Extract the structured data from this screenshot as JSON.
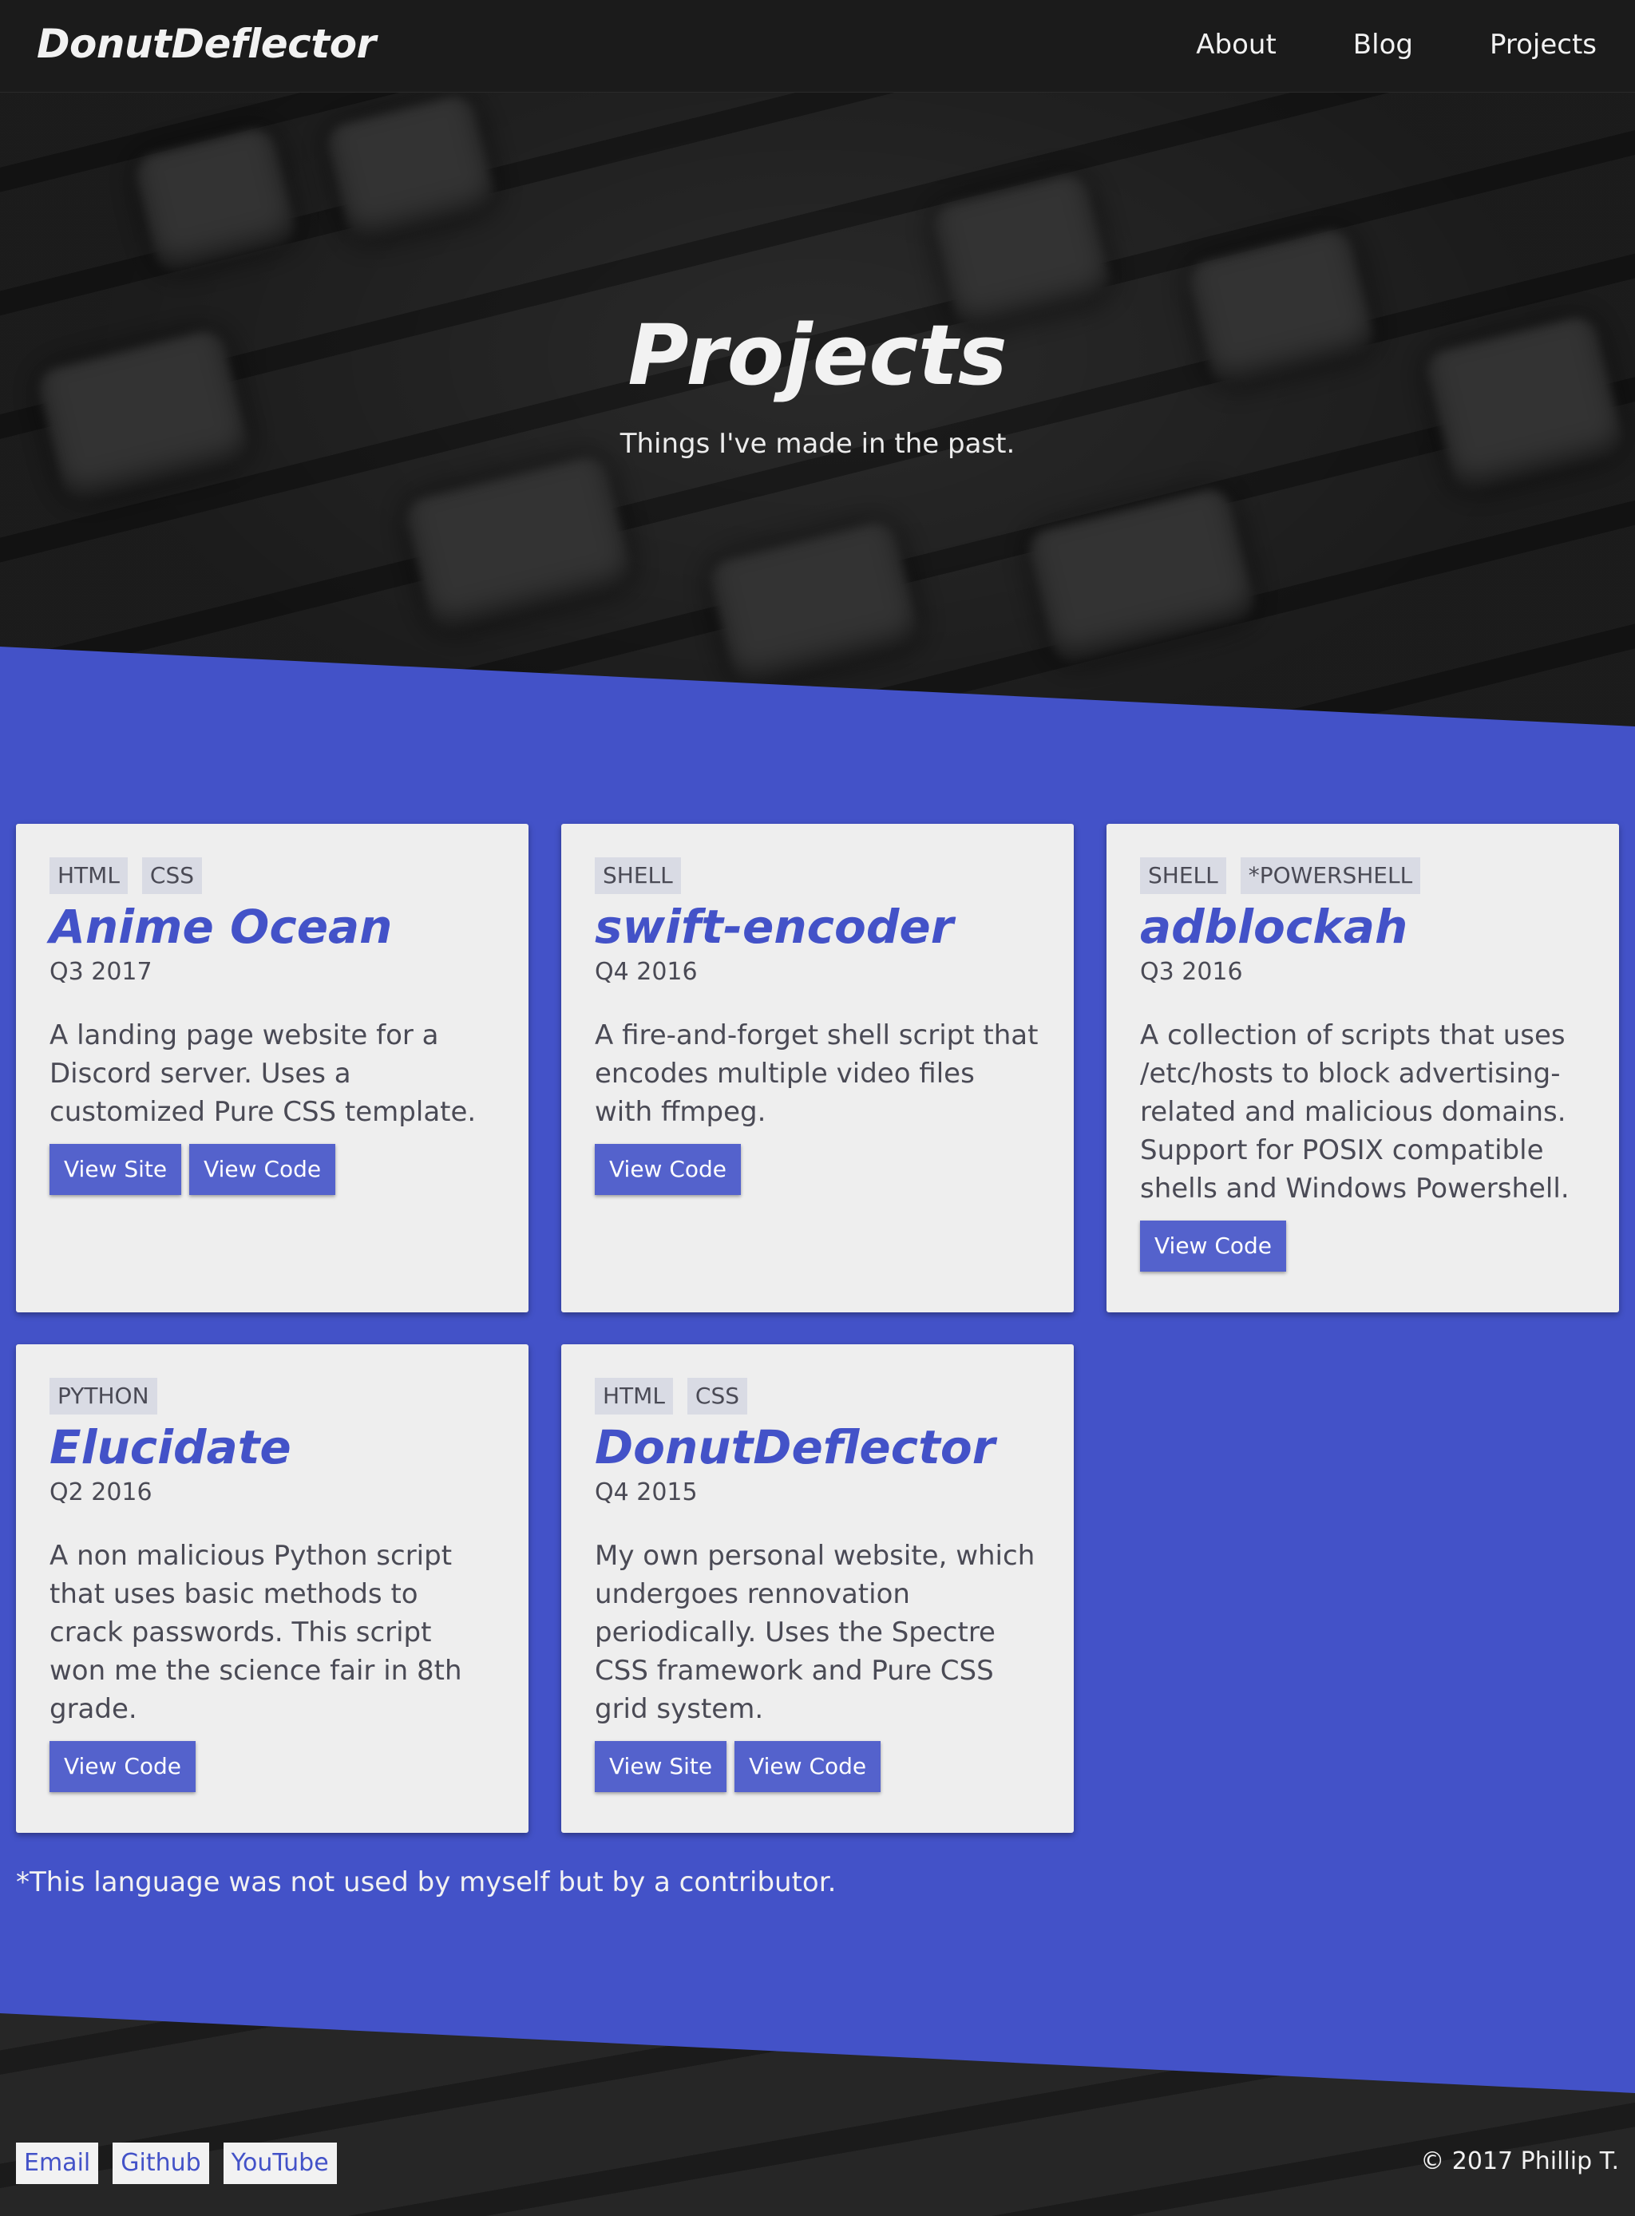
{
  "nav": {
    "brand": "DonutDeflector",
    "links": [
      "About",
      "Blog",
      "Projects"
    ]
  },
  "hero": {
    "title": "Projects",
    "subtitle": "Things I've made in the past."
  },
  "projects": [
    {
      "tags": [
        "HTML",
        "CSS"
      ],
      "title": "Anime Ocean",
      "date": "Q3 2017",
      "description": "A landing page website for a Discord server. Uses a customized Pure CSS template.",
      "buttons": [
        "View Site",
        "View Code"
      ]
    },
    {
      "tags": [
        "SHELL"
      ],
      "title": "swift-encoder",
      "date": "Q4 2016",
      "description": "A fire-and-forget shell script that encodes multiple video files with ffmpeg.",
      "buttons": [
        "View Code"
      ]
    },
    {
      "tags": [
        "SHELL",
        "*POWERSHELL"
      ],
      "title": "adblockah",
      "date": "Q3 2016",
      "description": "A collection of scripts that uses /etc/hosts to block advertising-related and malicious domains. Support for POSIX compatible shells and Windows Powershell.",
      "buttons": [
        "View Code"
      ]
    },
    {
      "tags": [
        "PYTHON"
      ],
      "title": "Elucidate",
      "date": "Q2 2016",
      "description": "A non malicious Python script that uses basic methods to crack passwords. This script won me the science fair in 8th grade.",
      "buttons": [
        "View Code"
      ]
    },
    {
      "tags": [
        "HTML",
        "CSS"
      ],
      "title": "DonutDeflector",
      "date": "Q4 2015",
      "description": "My own personal website, which undergoes rennovation periodically. Uses the Spectre CSS framework and Pure CSS grid system.",
      "buttons": [
        "View Site",
        "View Code"
      ]
    }
  ],
  "footnote": "*This language was not used by myself but by a contributor.",
  "footer": {
    "links": [
      "Email",
      "Github",
      "YouTube"
    ],
    "copyright": "© 2017 Phillip T."
  },
  "colors": {
    "accent": "#4352c8",
    "button": "#5462cc",
    "card": "#eeeeee",
    "navbar": "#1b1b1b"
  }
}
